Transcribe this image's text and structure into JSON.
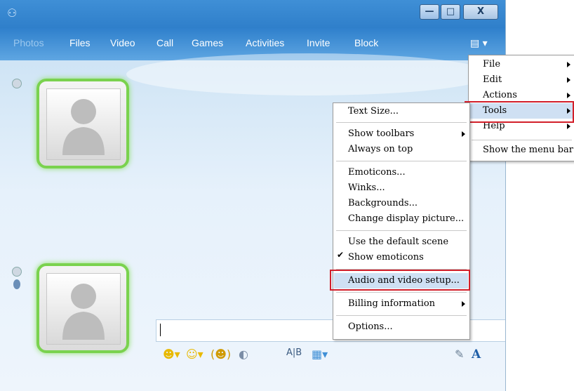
{
  "nav": {
    "items": [
      "Photos",
      "Files",
      "Video",
      "Call",
      "Games",
      "Activities",
      "Invite",
      "Block"
    ]
  },
  "window_buttons": {
    "minimize": "—",
    "maximize": "□",
    "close": "X"
  },
  "input": {
    "value": ""
  },
  "main_menu": {
    "items": [
      "File",
      "Edit",
      "Actions",
      "Tools",
      "Help"
    ],
    "show_menu_bar": "Show the menu bar",
    "highlighted": "Tools"
  },
  "tools_menu": {
    "groups": [
      [
        "Text Size..."
      ],
      [
        "Show toolbars",
        "Always on top"
      ],
      [
        "Emoticons...",
        "Winks...",
        "Backgrounds...",
        "Change display picture..."
      ],
      [
        "Use the default scene",
        "Show emoticons"
      ],
      [
        "Audio and video setup..."
      ],
      [
        "Billing information"
      ],
      [
        "Options..."
      ]
    ],
    "checked": "Show emoticons",
    "highlighted": "Audio and video setup..."
  },
  "colors": {
    "title_bar": "#3f8fd6",
    "avatar_glow": "#7ad24e",
    "highlight_box": "#d21f2a"
  }
}
